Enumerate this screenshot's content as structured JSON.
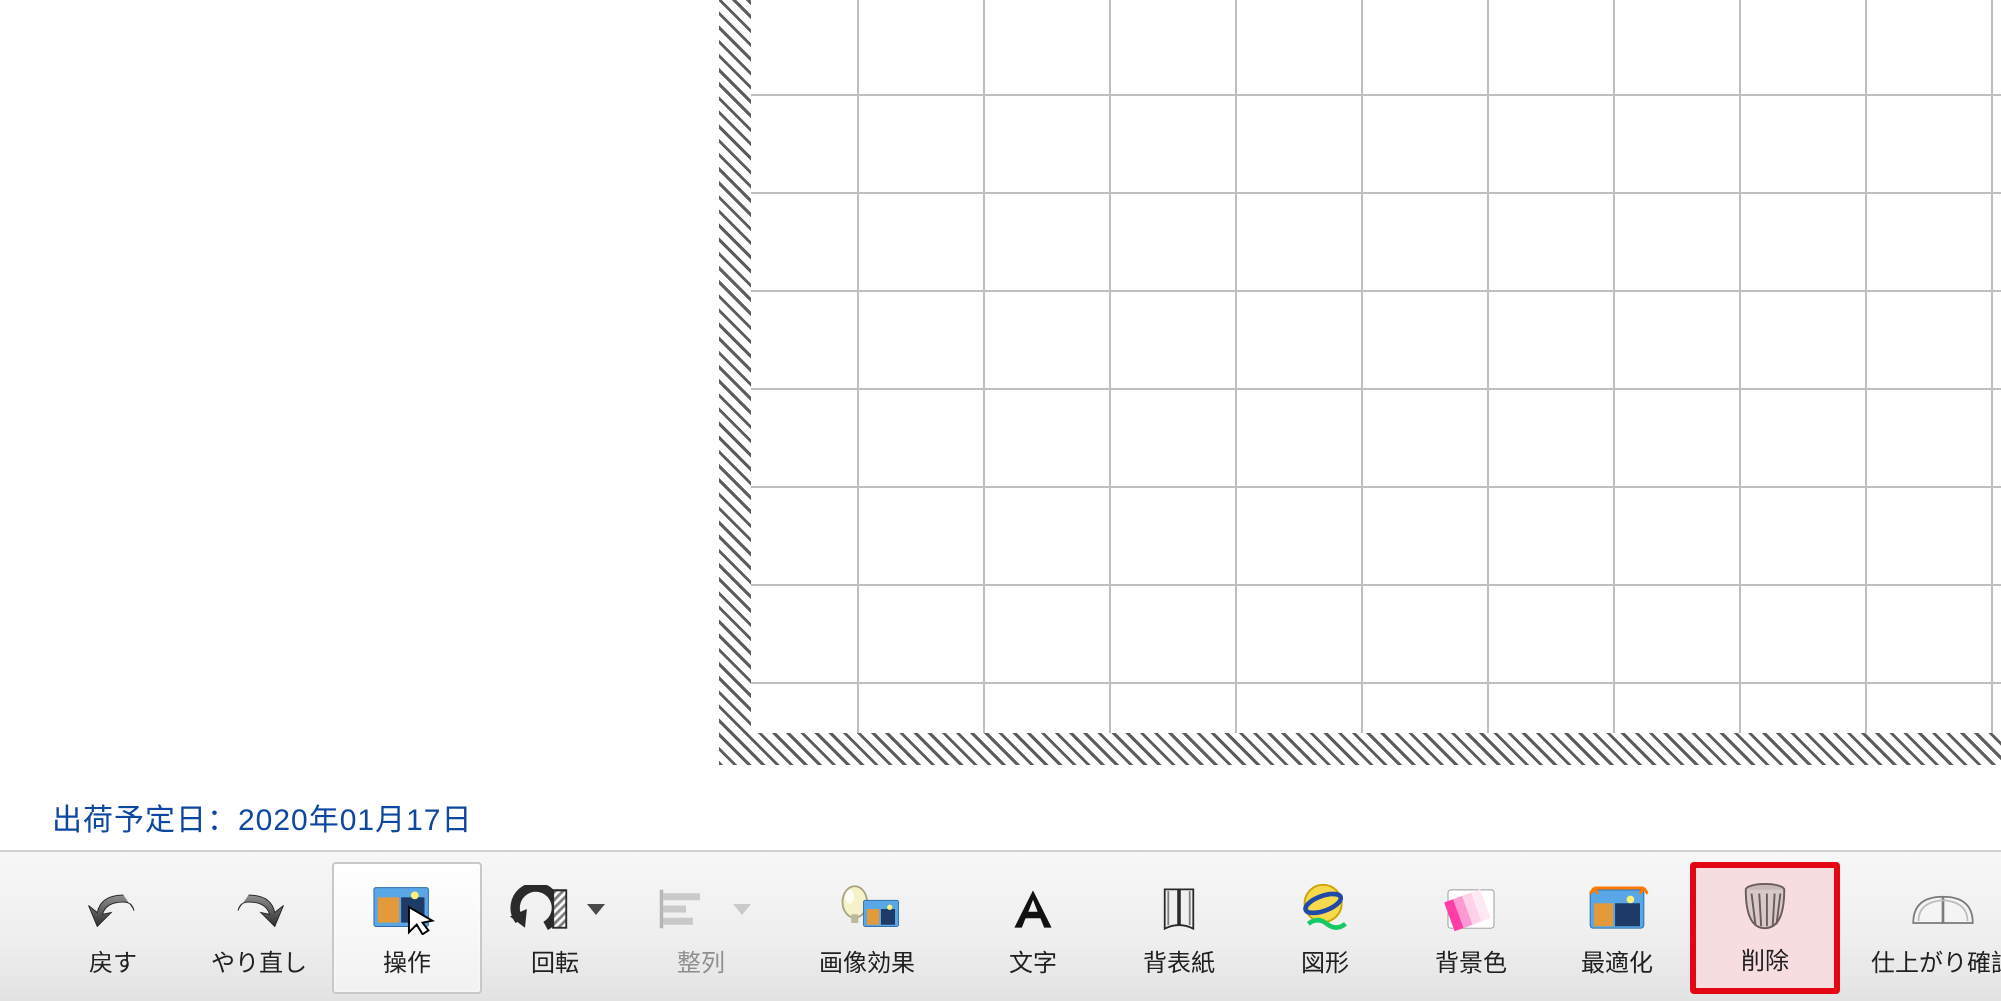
{
  "ship_date_text": "出荷予定日：2020年01月17日",
  "toolbar": {
    "undo": "戻す",
    "redo": "やり直し",
    "operate": "操作",
    "rotate": "回転",
    "align": "整列",
    "image_fx": "画像効果",
    "text": "文字",
    "cover": "背表紙",
    "shape": "図形",
    "bgcolor": "背景色",
    "optimize": "最適化",
    "delete": "削除",
    "preview": "仕上がり確認"
  }
}
